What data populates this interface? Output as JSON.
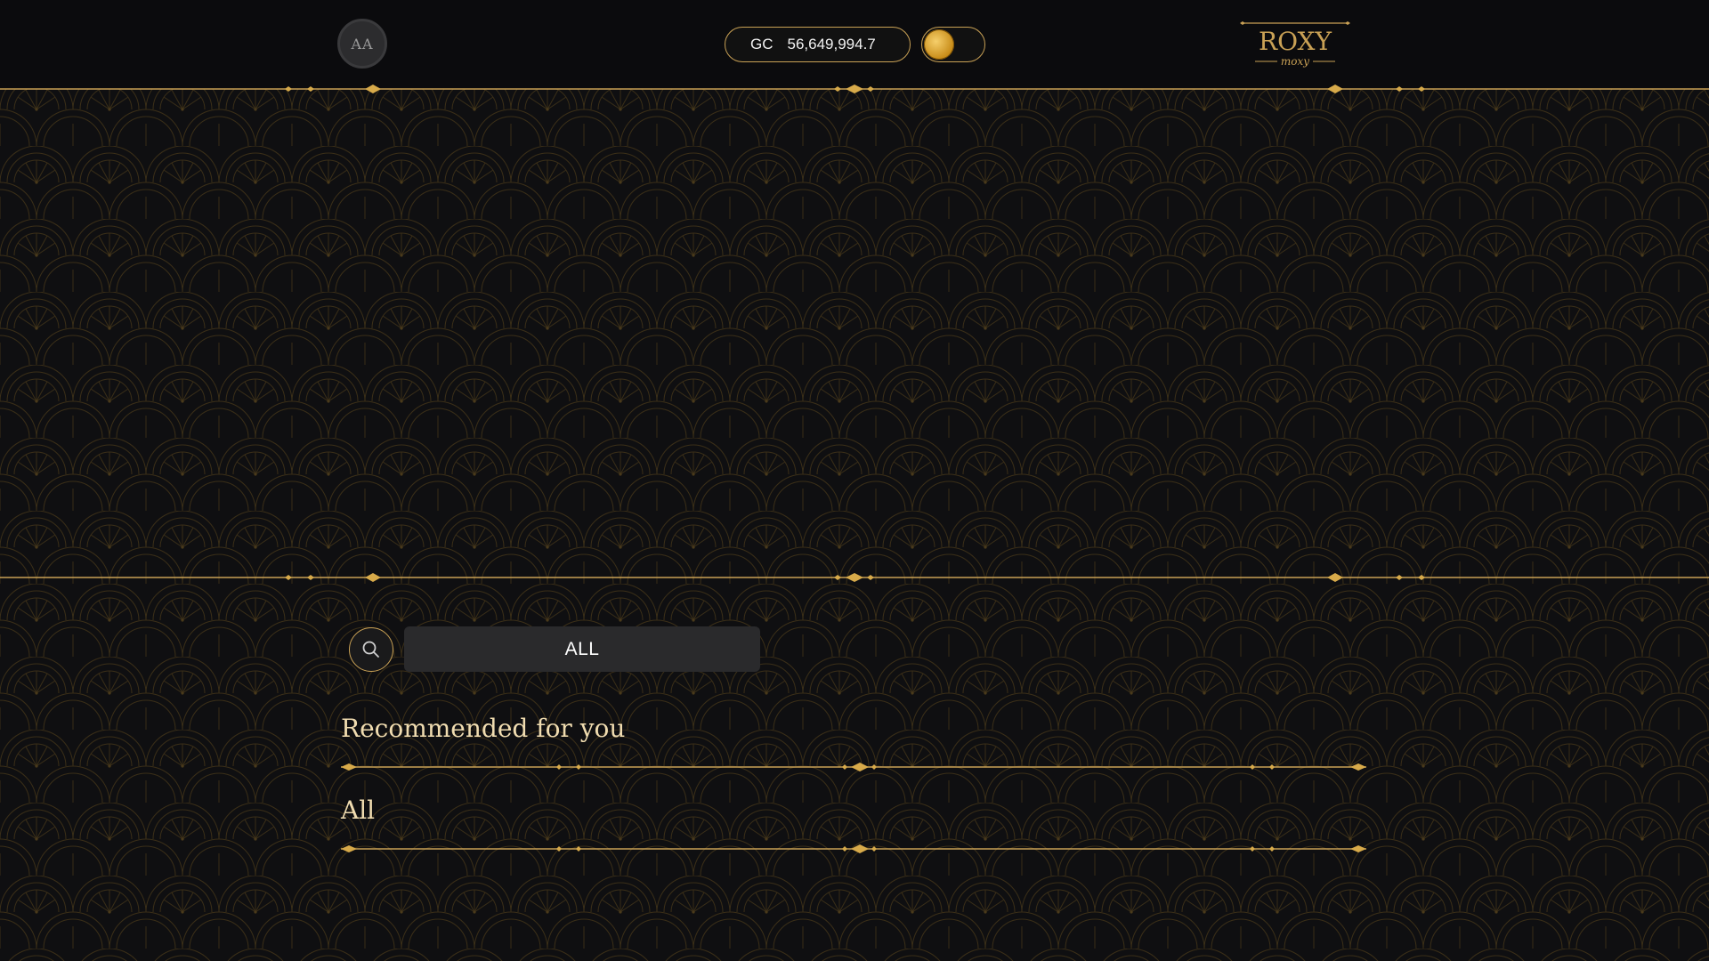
{
  "header": {
    "avatar_initials": "AA",
    "balance": {
      "currency": "GC",
      "amount": "56,649,994.7"
    },
    "logo": {
      "brand": "ROXY",
      "tagline": "moxy"
    }
  },
  "search": {
    "icon": "search-icon"
  },
  "filter": {
    "selected": "ALL"
  },
  "sections": [
    {
      "title": "Recommended for you"
    },
    {
      "title": "All"
    }
  ],
  "colors": {
    "gold": "#c9a155",
    "background": "#0f0f11",
    "filter_bg": "#2a2a2c"
  }
}
